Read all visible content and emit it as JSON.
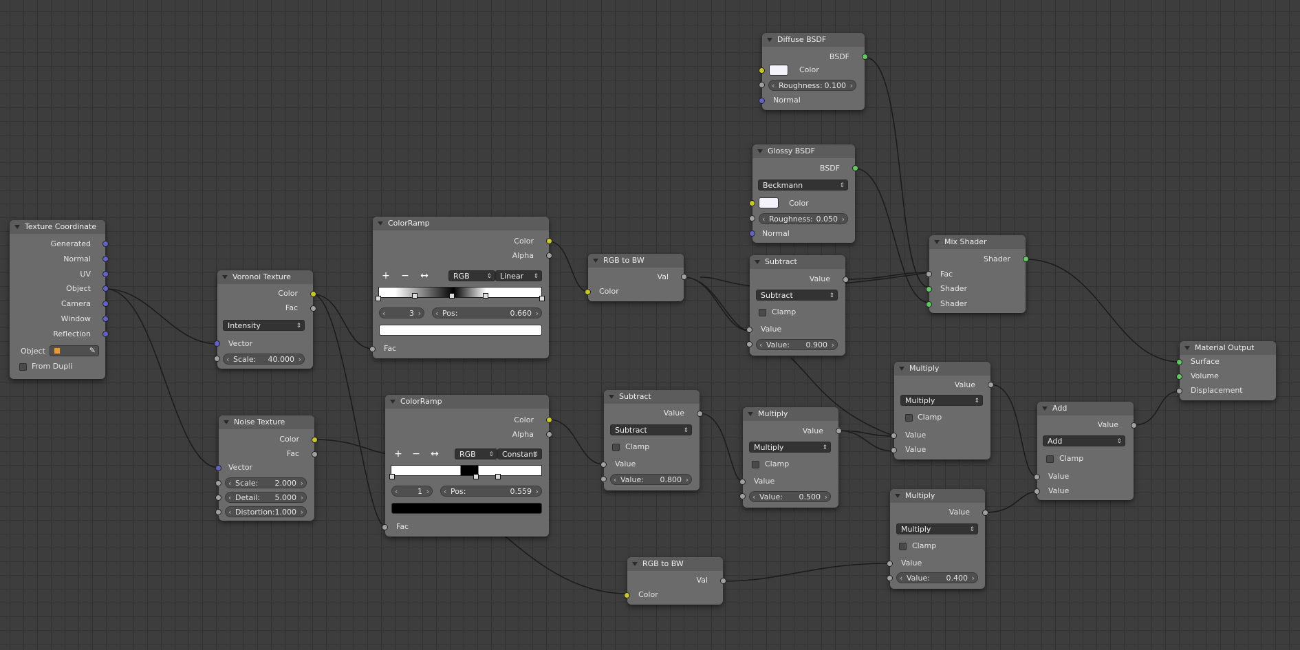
{
  "nodes": {
    "tex_coord": {
      "title": "Texture Coordinate",
      "outputs": [
        "Generated",
        "Normal",
        "UV",
        "Object",
        "Camera",
        "Window",
        "Reflection"
      ],
      "object_label": "Object",
      "from_dupli": "From Dupli"
    },
    "voronoi": {
      "title": "Voronoi Texture",
      "outputs": [
        "Color",
        "Fac"
      ],
      "mode": "Intensity",
      "input": "Vector",
      "scale_label": "Scale:",
      "scale": "40.000"
    },
    "noise": {
      "title": "Noise Texture",
      "outputs": [
        "Color",
        "Fac"
      ],
      "input": "Vector",
      "scale_label": "Scale:",
      "scale": "2.000",
      "detail_label": "Detail:",
      "detail": "5.000",
      "distortion_label": "Distortion:",
      "distortion": "1.000"
    },
    "ramp1": {
      "title": "ColorRamp",
      "outputs": [
        "Color",
        "Alpha"
      ],
      "color_mode": "RGB",
      "interp": "Linear",
      "index": "3",
      "pos_label": "Pos:",
      "pos": "0.660",
      "input": "Fac",
      "swatch_color": "#ffffff"
    },
    "ramp2": {
      "title": "ColorRamp",
      "outputs": [
        "Color",
        "Alpha"
      ],
      "color_mode": "RGB",
      "interp": "Constant",
      "index": "1",
      "pos_label": "Pos:",
      "pos": "0.559",
      "input": "Fac",
      "swatch_color": "#000000"
    },
    "rgbbw1": {
      "title": "RGB to BW",
      "output": "Val",
      "input": "Color"
    },
    "rgbbw2": {
      "title": "RGB to BW",
      "output": "Val",
      "input": "Color"
    },
    "sub1": {
      "title": "Subtract",
      "output": "Value",
      "op": "Subtract",
      "clamp": "Clamp",
      "input": "Value",
      "value_label": "Value:",
      "value": "0.900"
    },
    "sub2": {
      "title": "Subtract",
      "output": "Value",
      "op": "Subtract",
      "clamp": "Clamp",
      "input": "Value",
      "value_label": "Value:",
      "value": "0.800"
    },
    "mul1": {
      "title": "Multiply",
      "output": "Value",
      "op": "Multiply",
      "clamp": "Clamp",
      "input": "Value",
      "value_label": "Value:",
      "value": "0.500"
    },
    "mul2": {
      "title": "Multiply",
      "output": "Value",
      "op": "Multiply",
      "clamp": "Clamp",
      "inputs": [
        "Value",
        "Value"
      ]
    },
    "mul3": {
      "title": "Multiply",
      "output": "Value",
      "op": "Multiply",
      "clamp": "Clamp",
      "input": "Value",
      "value_label": "Value:",
      "value": "0.400"
    },
    "add": {
      "title": "Add",
      "output": "Value",
      "op": "Add",
      "clamp": "Clamp",
      "inputs": [
        "Value",
        "Value"
      ]
    },
    "diffuse": {
      "title": "Diffuse BSDF",
      "output": "BSDF",
      "color": "Color",
      "rough_label": "Roughness:",
      "rough": "0.100",
      "normal": "Normal"
    },
    "glossy": {
      "title": "Glossy BSDF",
      "output": "BSDF",
      "dist": "Beckmann",
      "color": "Color",
      "rough_label": "Roughness:",
      "rough": "0.050",
      "normal": "Normal"
    },
    "mix": {
      "title": "Mix Shader",
      "output": "Shader",
      "inputs": [
        "Fac",
        "Shader",
        "Shader"
      ]
    },
    "matout": {
      "title": "Material Output",
      "inputs": [
        "Surface",
        "Volume",
        "Displacement"
      ]
    }
  },
  "colors": {
    "vector_socket": "#6363c7",
    "color_socket": "#c7c729",
    "value_socket": "#a1a1a1",
    "shader_socket": "#63c763",
    "wire": "#1e1e1e"
  }
}
